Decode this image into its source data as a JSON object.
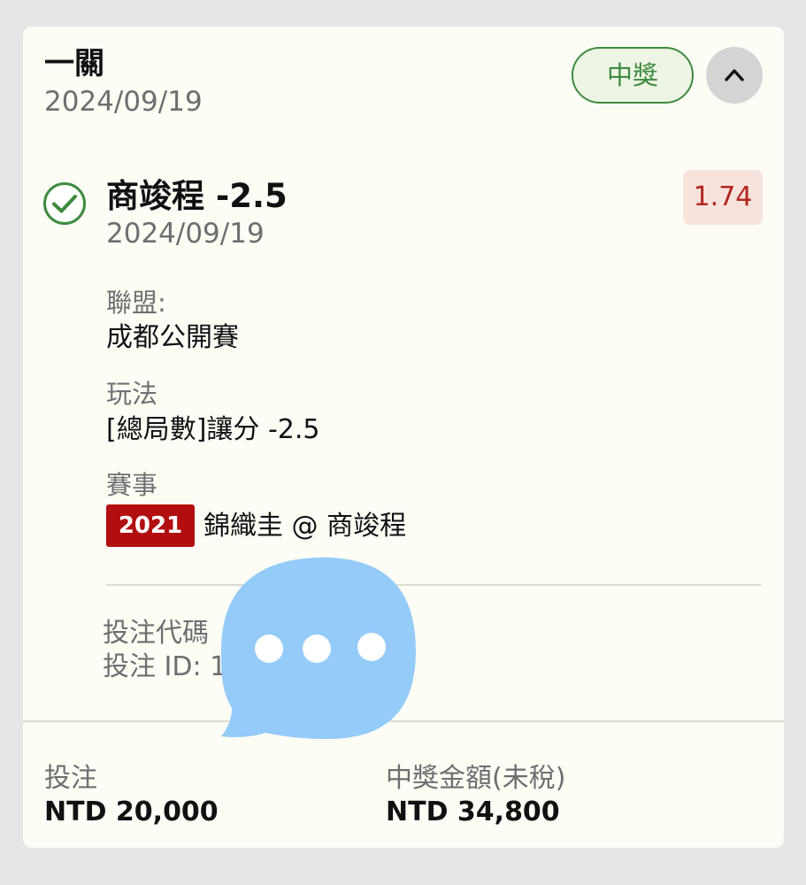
{
  "header": {
    "title": "一關",
    "date": "2024/09/19",
    "status_badge": "中獎",
    "collapse_icon": "chevron-up-icon"
  },
  "selection": {
    "status_icon": "check-circle-icon",
    "name": "商竣程 -2.5",
    "date": "2024/09/19",
    "odds": "1.74"
  },
  "details": {
    "league_label": "聯盟:",
    "league_value": "成都公開賽",
    "play_label": "玩法",
    "play_value": "[總局數]讓分 -2.5",
    "event_label": "賽事",
    "event_badge": "2021",
    "event_teams": "錦織圭 @ 商竣程"
  },
  "bet_code": {
    "code_label": "投注代碼",
    "id_label": "投注 ID: 1"
  },
  "footer": {
    "stake_label": "投注",
    "stake_value": "NTD 20,000",
    "payout_label": "中獎金額(未稅)",
    "payout_value": "NTD 34,800"
  },
  "colors": {
    "accent_green": "#3d8b3d",
    "odds_red": "#b3261e",
    "badge_red": "#b20e10",
    "sticker_blue": "#94cbf9"
  }
}
